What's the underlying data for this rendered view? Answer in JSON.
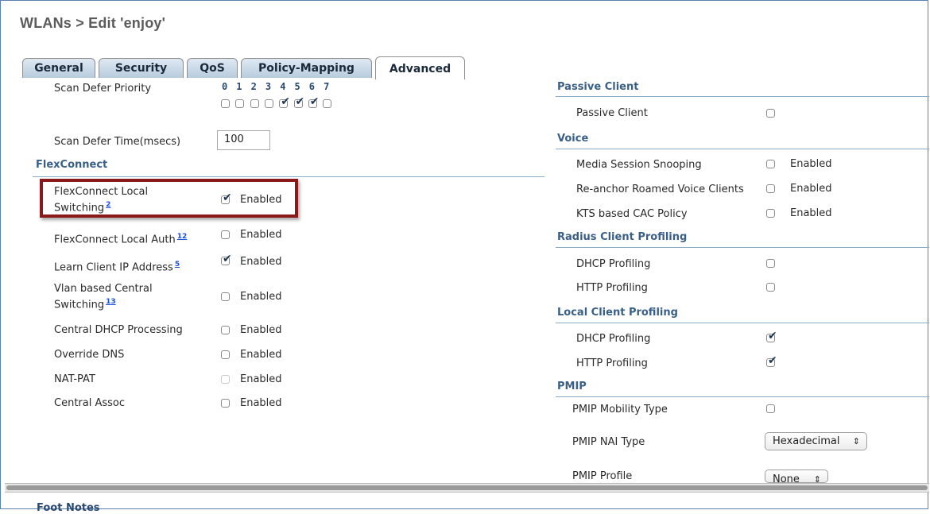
{
  "page": {
    "title": "WLANs > Edit  'enjoy'"
  },
  "tabs": [
    "General",
    "Security",
    "QoS",
    "Policy-Mapping",
    "Advanced"
  ],
  "active_tab": "Advanced",
  "left": {
    "scan_defer_priority": {
      "label": "Scan Defer Priority",
      "digits": [
        "0",
        "1",
        "2",
        "3",
        "4",
        "5",
        "6",
        "7"
      ],
      "checked": [
        false,
        false,
        false,
        false,
        true,
        true,
        true,
        false
      ]
    },
    "scan_defer_time": {
      "label": "Scan Defer Time(msecs)",
      "value": "100"
    },
    "flexconnect_header": "FlexConnect",
    "rows": [
      {
        "label": "FlexConnect Local Switching",
        "label_lines": [
          "FlexConnect Local",
          "Switching"
        ],
        "sup": "2",
        "checked": true,
        "state": "Enabled"
      },
      {
        "label": "FlexConnect Local Auth",
        "sup": "12",
        "checked": false,
        "state": "Enabled"
      },
      {
        "label": "Learn Client IP Address",
        "sup": "5",
        "checked": true,
        "state": "Enabled"
      },
      {
        "label": "Vlan based Central Switching",
        "label_lines": [
          "Vlan based Central",
          "Switching"
        ],
        "sup": "13",
        "checked": false,
        "state": "Enabled"
      },
      {
        "label": "Central DHCP Processing",
        "checked": false,
        "state": "Enabled"
      },
      {
        "label": "Override DNS",
        "checked": false,
        "state": "Enabled"
      },
      {
        "label": "NAT-PAT",
        "checked": false,
        "disabled": true,
        "state": "Enabled"
      },
      {
        "label": "Central Assoc",
        "checked": false,
        "state": "Enabled"
      }
    ]
  },
  "right": {
    "passive_client": {
      "header": "Passive Client",
      "label": "Passive Client",
      "checked": false
    },
    "voice": {
      "header": "Voice",
      "rows": [
        {
          "label": "Media Session Snooping",
          "checked": false,
          "state": "Enabled"
        },
        {
          "label": "Re-anchor Roamed Voice Clients",
          "checked": false,
          "state": "Enabled"
        },
        {
          "label": "KTS based CAC Policy",
          "checked": false,
          "state": "Enabled"
        }
      ]
    },
    "radius_profiling": {
      "header": "Radius Client Profiling",
      "rows": [
        {
          "label": "DHCP Profiling",
          "checked": false
        },
        {
          "label": "HTTP Profiling",
          "checked": false
        }
      ]
    },
    "local_profiling": {
      "header": "Local Client Profiling",
      "rows": [
        {
          "label": "DHCP Profiling",
          "checked": true
        },
        {
          "label": "HTTP Profiling",
          "checked": true
        }
      ]
    },
    "pmip": {
      "header": "PMIP",
      "mobility_type": {
        "label": "PMIP Mobility Type",
        "checked": false
      },
      "nai_type": {
        "label": "PMIP NAI Type",
        "value": "Hexadecimal"
      },
      "profile": {
        "label": "PMIP Profile",
        "value": "None"
      }
    }
  },
  "footer": {
    "label": "Foot Notes"
  },
  "icons": {
    "checkbox_checked": "checkmark",
    "select_arrow": "updown-arrows"
  }
}
